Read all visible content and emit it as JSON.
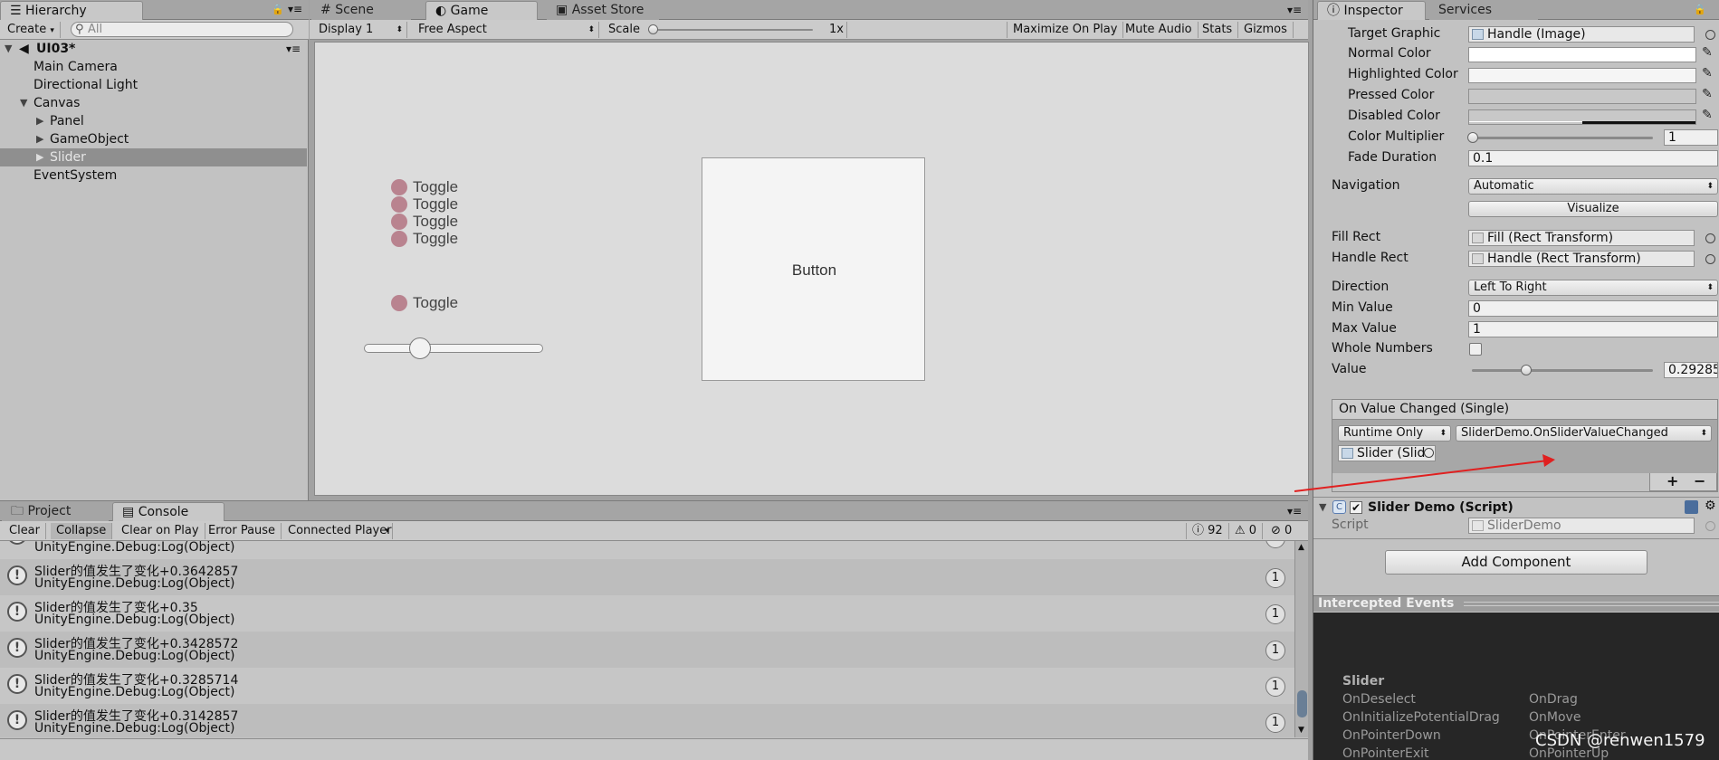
{
  "hierarchy": {
    "tab": "Hierarchy",
    "create": "Create",
    "search_placeholder": "All",
    "scene": "UI03*",
    "items": [
      {
        "label": "Main Camera"
      },
      {
        "label": "Directional Light"
      },
      {
        "label": "Canvas"
      },
      {
        "label": "Panel"
      },
      {
        "label": "GameObject"
      },
      {
        "label": "Slider"
      },
      {
        "label": "EventSystem"
      }
    ]
  },
  "game": {
    "tabs": [
      "Scene",
      "Game",
      "Asset Store"
    ],
    "display": "Display 1",
    "aspect": "Free Aspect",
    "scale_label": "Scale",
    "scale_value": "1x",
    "toolbar": [
      "Maximize On Play",
      "Mute Audio",
      "Stats",
      "Gizmos"
    ],
    "toggles": [
      "Toggle",
      "Toggle",
      "Toggle",
      "Toggle",
      "Toggle"
    ],
    "button_label": "Button",
    "slider_value": 0.29
  },
  "inspector": {
    "tabs": [
      "Inspector",
      "Services"
    ],
    "target_graphic_label": "Target Graphic",
    "target_graphic": "Handle (Image)",
    "normal_color": "Normal Color",
    "highlighted_color": "Highlighted Color",
    "pressed_color": "Pressed Color",
    "disabled_color": "Disabled Color",
    "color_multiplier_label": "Color Multiplier",
    "color_multiplier": "1",
    "fade_duration_label": "Fade Duration",
    "fade_duration": "0.1",
    "navigation_label": "Navigation",
    "navigation": "Automatic",
    "visualize": "Visualize",
    "fill_rect_label": "Fill Rect",
    "fill_rect": "Fill (Rect Transform)",
    "handle_rect_label": "Handle Rect",
    "handle_rect": "Handle (Rect Transform)",
    "direction_label": "Direction",
    "direction": "Left To Right",
    "min_value_label": "Min Value",
    "min_value": "0",
    "max_value_label": "Max Value",
    "max_value": "1",
    "whole_numbers_label": "Whole Numbers",
    "value_label": "Value",
    "value": "0.29285",
    "event_header": "On Value Changed (Single)",
    "runtime": "Runtime Only",
    "function": "SliderDemo.OnSliderValueChanged",
    "event_object": "Slider (Slid",
    "plus": "+",
    "minus": "−",
    "script_component": "Slider Demo (Script)",
    "script_label": "Script",
    "script_value": "SliderDemo",
    "add_component": "Add Component",
    "intercepted_events": "Intercepted Events",
    "events_title": "Slider",
    "events_left": [
      "OnDeselect",
      "OnInitializePotentialDrag",
      "OnPointerDown",
      "OnPointerExit"
    ],
    "events_right": [
      "OnDrag",
      "OnMove",
      "OnPointerEnter",
      "OnPointerUp"
    ]
  },
  "console": {
    "tabs": [
      "Project",
      "Console"
    ],
    "toolbar": [
      "Clear",
      "Collapse",
      "Clear on Play",
      "Error Pause",
      "Connected Player"
    ],
    "log_count": "92",
    "warn_count": "0",
    "error_count": "0",
    "partial_line": "UnityEngine.Debug:Log(Object)",
    "rows": [
      {
        "line1": "Slider的值发生了变化+0.3642857",
        "line2": "UnityEngine.Debug:Log(Object)",
        "count": "1"
      },
      {
        "line1": "Slider的值发生了变化+0.35",
        "line2": "UnityEngine.Debug:Log(Object)",
        "count": "1"
      },
      {
        "line1": "Slider的值发生了变化+0.3428572",
        "line2": "UnityEngine.Debug:Log(Object)",
        "count": "1"
      },
      {
        "line1": "Slider的值发生了变化+0.3285714",
        "line2": "UnityEngine.Debug:Log(Object)",
        "count": "1"
      },
      {
        "line1": "Slider的值发生了变化+0.3142857",
        "line2": "UnityEngine.Debug:Log(Object)",
        "count": "1"
      }
    ]
  },
  "watermark": "CSDN @renwen1579"
}
